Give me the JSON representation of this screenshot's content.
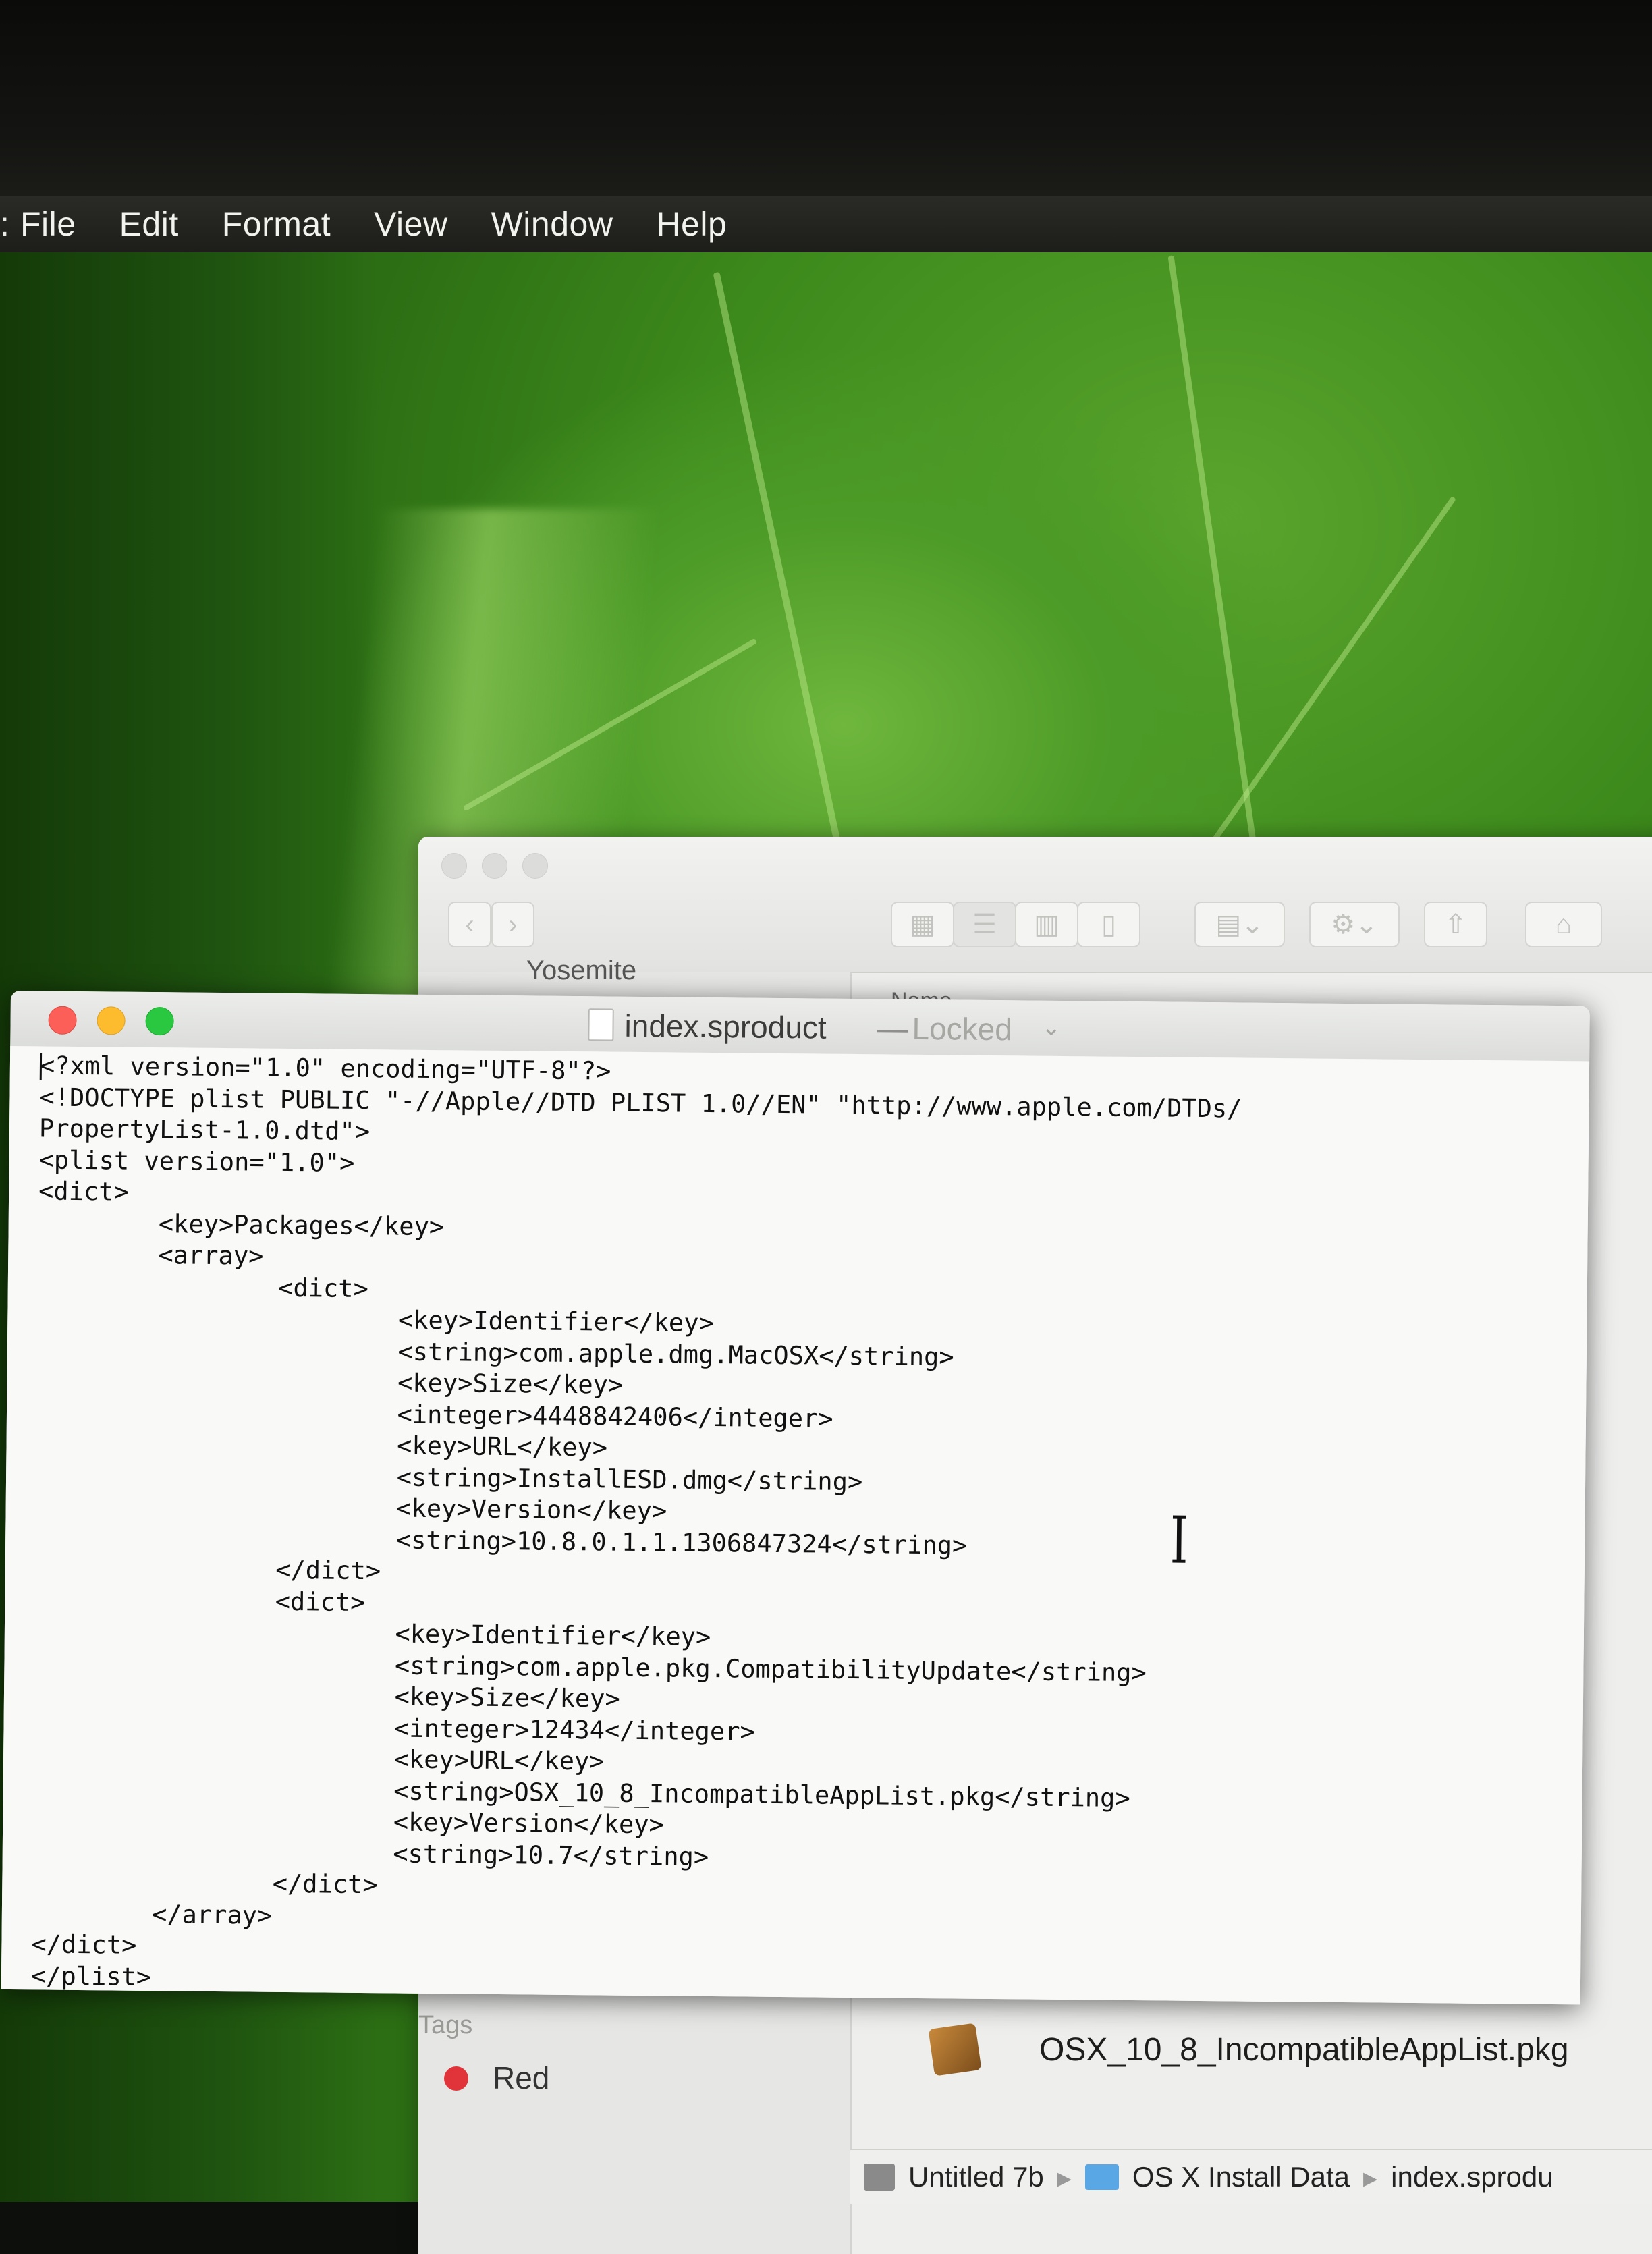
{
  "menubar": {
    "apple_fragment": ":",
    "items": [
      "File",
      "Edit",
      "Format",
      "View",
      "Window",
      "Help"
    ]
  },
  "finder": {
    "sidebar_item_partial": "Yosemite",
    "column_partial": "Name",
    "tags_heading": "Tags",
    "tag_red": "Red",
    "file_name": "OSX_10_8_IncompatibleAppList.pkg",
    "path": [
      "Untitled 7b",
      "OS X Install Data",
      "index.sprodu"
    ]
  },
  "textedit": {
    "title": "index.sproduct",
    "separator": "—",
    "lock_status": "Locked",
    "lines": [
      "<?xml version=\"1.0\" encoding=\"UTF-8\"?>",
      "<!DOCTYPE plist PUBLIC \"-//Apple//DTD PLIST 1.0//EN\" \"http://www.apple.com/DTDs/",
      "PropertyList-1.0.dtd\">",
      "<plist version=\"1.0\">",
      "<dict>",
      "        <key>Packages</key>",
      "        <array>",
      "                <dict>",
      "                        <key>Identifier</key>",
      "                        <string>com.apple.dmg.MacOSX</string>",
      "                        <key>Size</key>",
      "                        <integer>4448842406</integer>",
      "                        <key>URL</key>",
      "                        <string>InstallESD.dmg</string>",
      "                        <key>Version</key>",
      "                        <string>10.8.0.1.1.1306847324</string>",
      "                </dict>",
      "                <dict>",
      "                        <key>Identifier</key>",
      "                        <string>com.apple.pkg.CompatibilityUpdate</string>",
      "                        <key>Size</key>",
      "                        <integer>12434</integer>",
      "                        <key>URL</key>",
      "                        <string>OSX_10_8_IncompatibleAppList.pkg</string>",
      "                        <key>Version</key>",
      "                        <string>10.7</string>",
      "                </dict>",
      "        </array>",
      "</dict>",
      "</plist>"
    ]
  },
  "icons": {
    "document": "document-icon",
    "cursor": "i-beam-cursor-icon",
    "folder": "folder-icon",
    "disk": "disk-icon"
  }
}
